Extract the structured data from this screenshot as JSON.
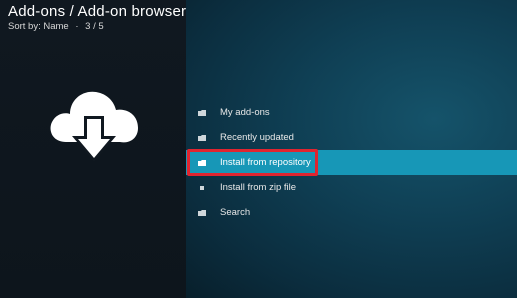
{
  "header": {
    "title": "Add-ons / Add-on browser",
    "sort_label": "Sort by: Name",
    "separator": "·",
    "page_count": "3 / 5"
  },
  "hero_icon": "cloud-download-icon",
  "menu": {
    "items": [
      {
        "label": "My add-ons",
        "icon": "folder-icon"
      },
      {
        "label": "Recently updated",
        "icon": "folder-icon"
      },
      {
        "label": "Install from repository",
        "icon": "folder-icon",
        "selected": true
      },
      {
        "label": "Install from zip file",
        "icon": "square-icon"
      },
      {
        "label": "Search",
        "icon": "folder-icon"
      }
    ]
  },
  "colors": {
    "selection": "#1797b7",
    "highlight_border": "#e02530",
    "left_panel": "#101820",
    "main_panel": "#0f3f54"
  }
}
